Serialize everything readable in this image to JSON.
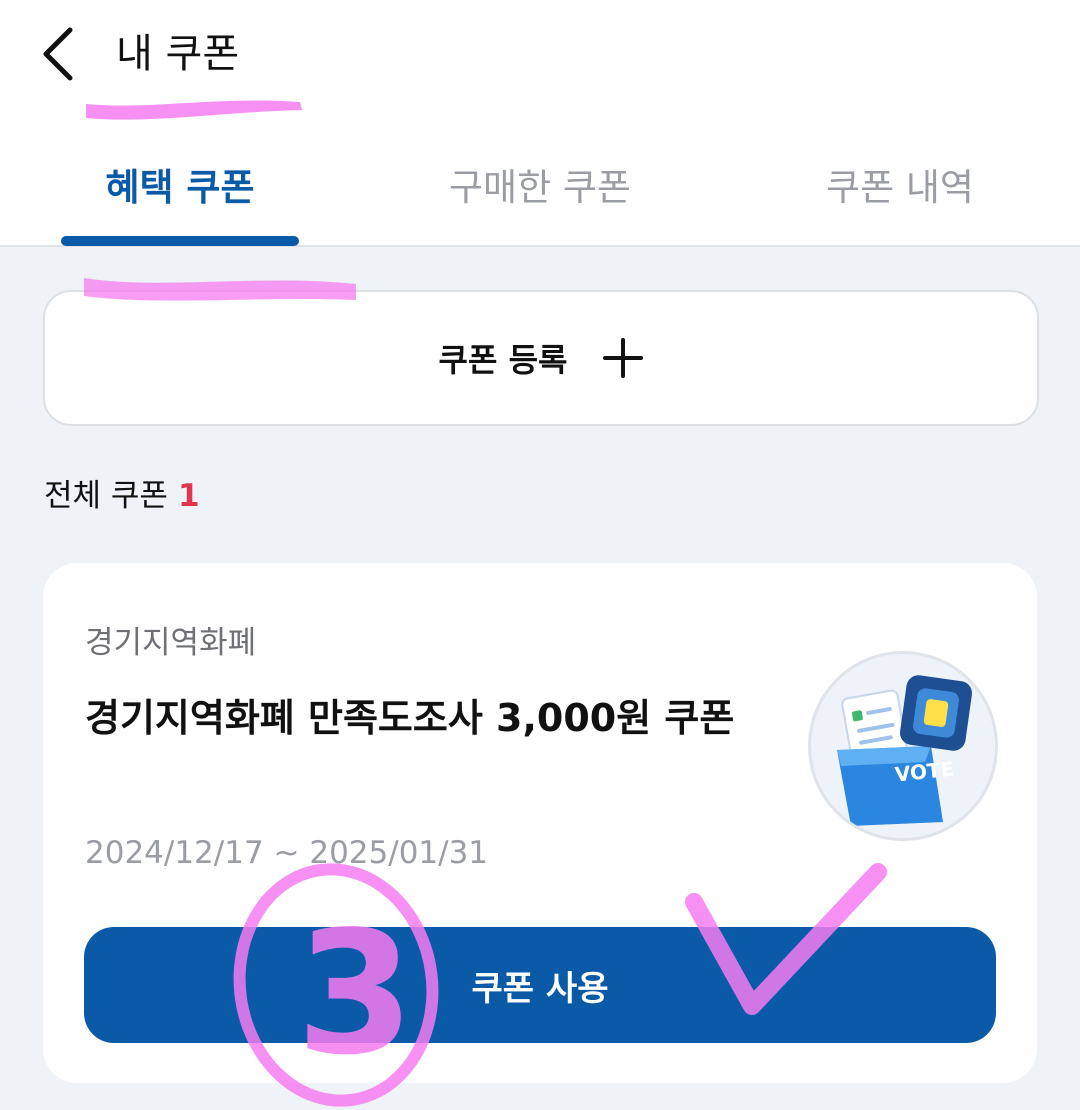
{
  "header": {
    "title": "내 쿠폰",
    "back_icon": "chevron-left-icon"
  },
  "tabs": [
    {
      "label": "혜택 쿠폰",
      "active": true
    },
    {
      "label": "구매한 쿠폰",
      "active": false
    },
    {
      "label": "쿠폰 내역",
      "active": false
    }
  ],
  "register": {
    "label": "쿠폰 등록",
    "icon": "plus-icon"
  },
  "summary": {
    "label": "전체 쿠폰",
    "count": "1"
  },
  "coupon": {
    "brand": "경기지역화폐",
    "title": "경기지역화폐 만족도조사 3,000원 쿠폰",
    "dates": "2024/12/17 ~ 2025/01/31",
    "image_text": "VOTE",
    "button_label": "쿠폰 사용"
  },
  "annotation": {
    "circled_number": "3",
    "marker_color": "#f57cf0"
  },
  "colors": {
    "accent": "#0a5aa8",
    "count_red": "#e2334f",
    "background": "#eff2f7"
  }
}
